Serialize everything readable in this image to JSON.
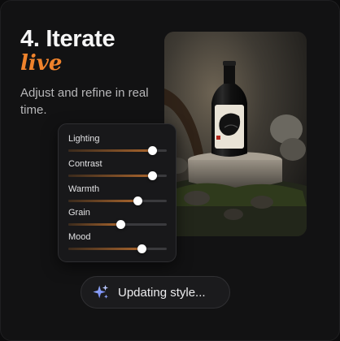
{
  "step": {
    "title": "4. Iterate",
    "accent": "live",
    "description": "Adjust and refine in real time."
  },
  "image": {
    "subject": "bottle-on-stone-with-moss"
  },
  "adjustments": {
    "sliders": [
      {
        "label": "Lighting",
        "value": 0.85
      },
      {
        "label": "Contrast",
        "value": 0.85
      },
      {
        "label": "Warmth",
        "value": 0.7
      },
      {
        "label": "Grain",
        "value": 0.53
      },
      {
        "label": "Mood",
        "value": 0.74
      }
    ]
  },
  "status": {
    "icon": "sparkles-icon",
    "text": "Updating style..."
  },
  "colors": {
    "accent": "#f0832c",
    "background": "#121213",
    "panel": "#18181a"
  }
}
